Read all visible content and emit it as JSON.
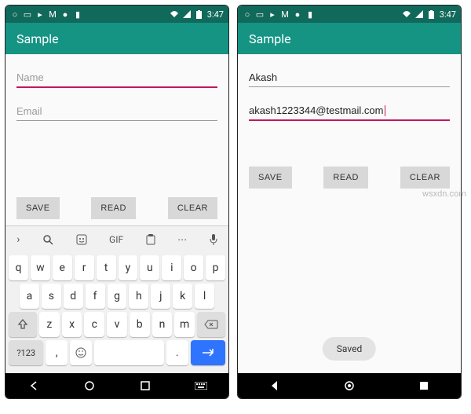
{
  "watermark": "wsxdn.com",
  "statusbar": {
    "time": "3:47",
    "icons": [
      "circle",
      "square",
      "play",
      "mail",
      "notif",
      "bookmark"
    ],
    "right_icons": [
      "wifi",
      "signal",
      "battery"
    ]
  },
  "appbar": {
    "title": "Sample"
  },
  "left": {
    "name_field": {
      "placeholder": "Name",
      "value": ""
    },
    "email_field": {
      "placeholder": "Email",
      "value": ""
    },
    "name_active": true
  },
  "right": {
    "name_field": {
      "placeholder": "Name",
      "value": "Akash"
    },
    "email_field": {
      "placeholder": "Email",
      "value": "akash1223344@testmail.com"
    },
    "email_active": true,
    "toast": "Saved"
  },
  "buttons": {
    "save": "SAVE",
    "read": "READ",
    "clear": "CLEAR"
  },
  "keyboard": {
    "suggest": {
      "gif": "GIF"
    },
    "row1": [
      "q",
      "w",
      "e",
      "r",
      "t",
      "y",
      "u",
      "i",
      "o",
      "p"
    ],
    "row2": [
      "a",
      "s",
      "d",
      "f",
      "g",
      "h",
      "j",
      "k",
      "l"
    ],
    "row3_mid": [
      "z",
      "x",
      "c",
      "v",
      "b",
      "n",
      "m"
    ],
    "sym": "?123",
    "comma": ",",
    "period": "."
  },
  "nav": {
    "back": "back",
    "home": "home",
    "recent": "recent",
    "kbd": "keyboard"
  }
}
